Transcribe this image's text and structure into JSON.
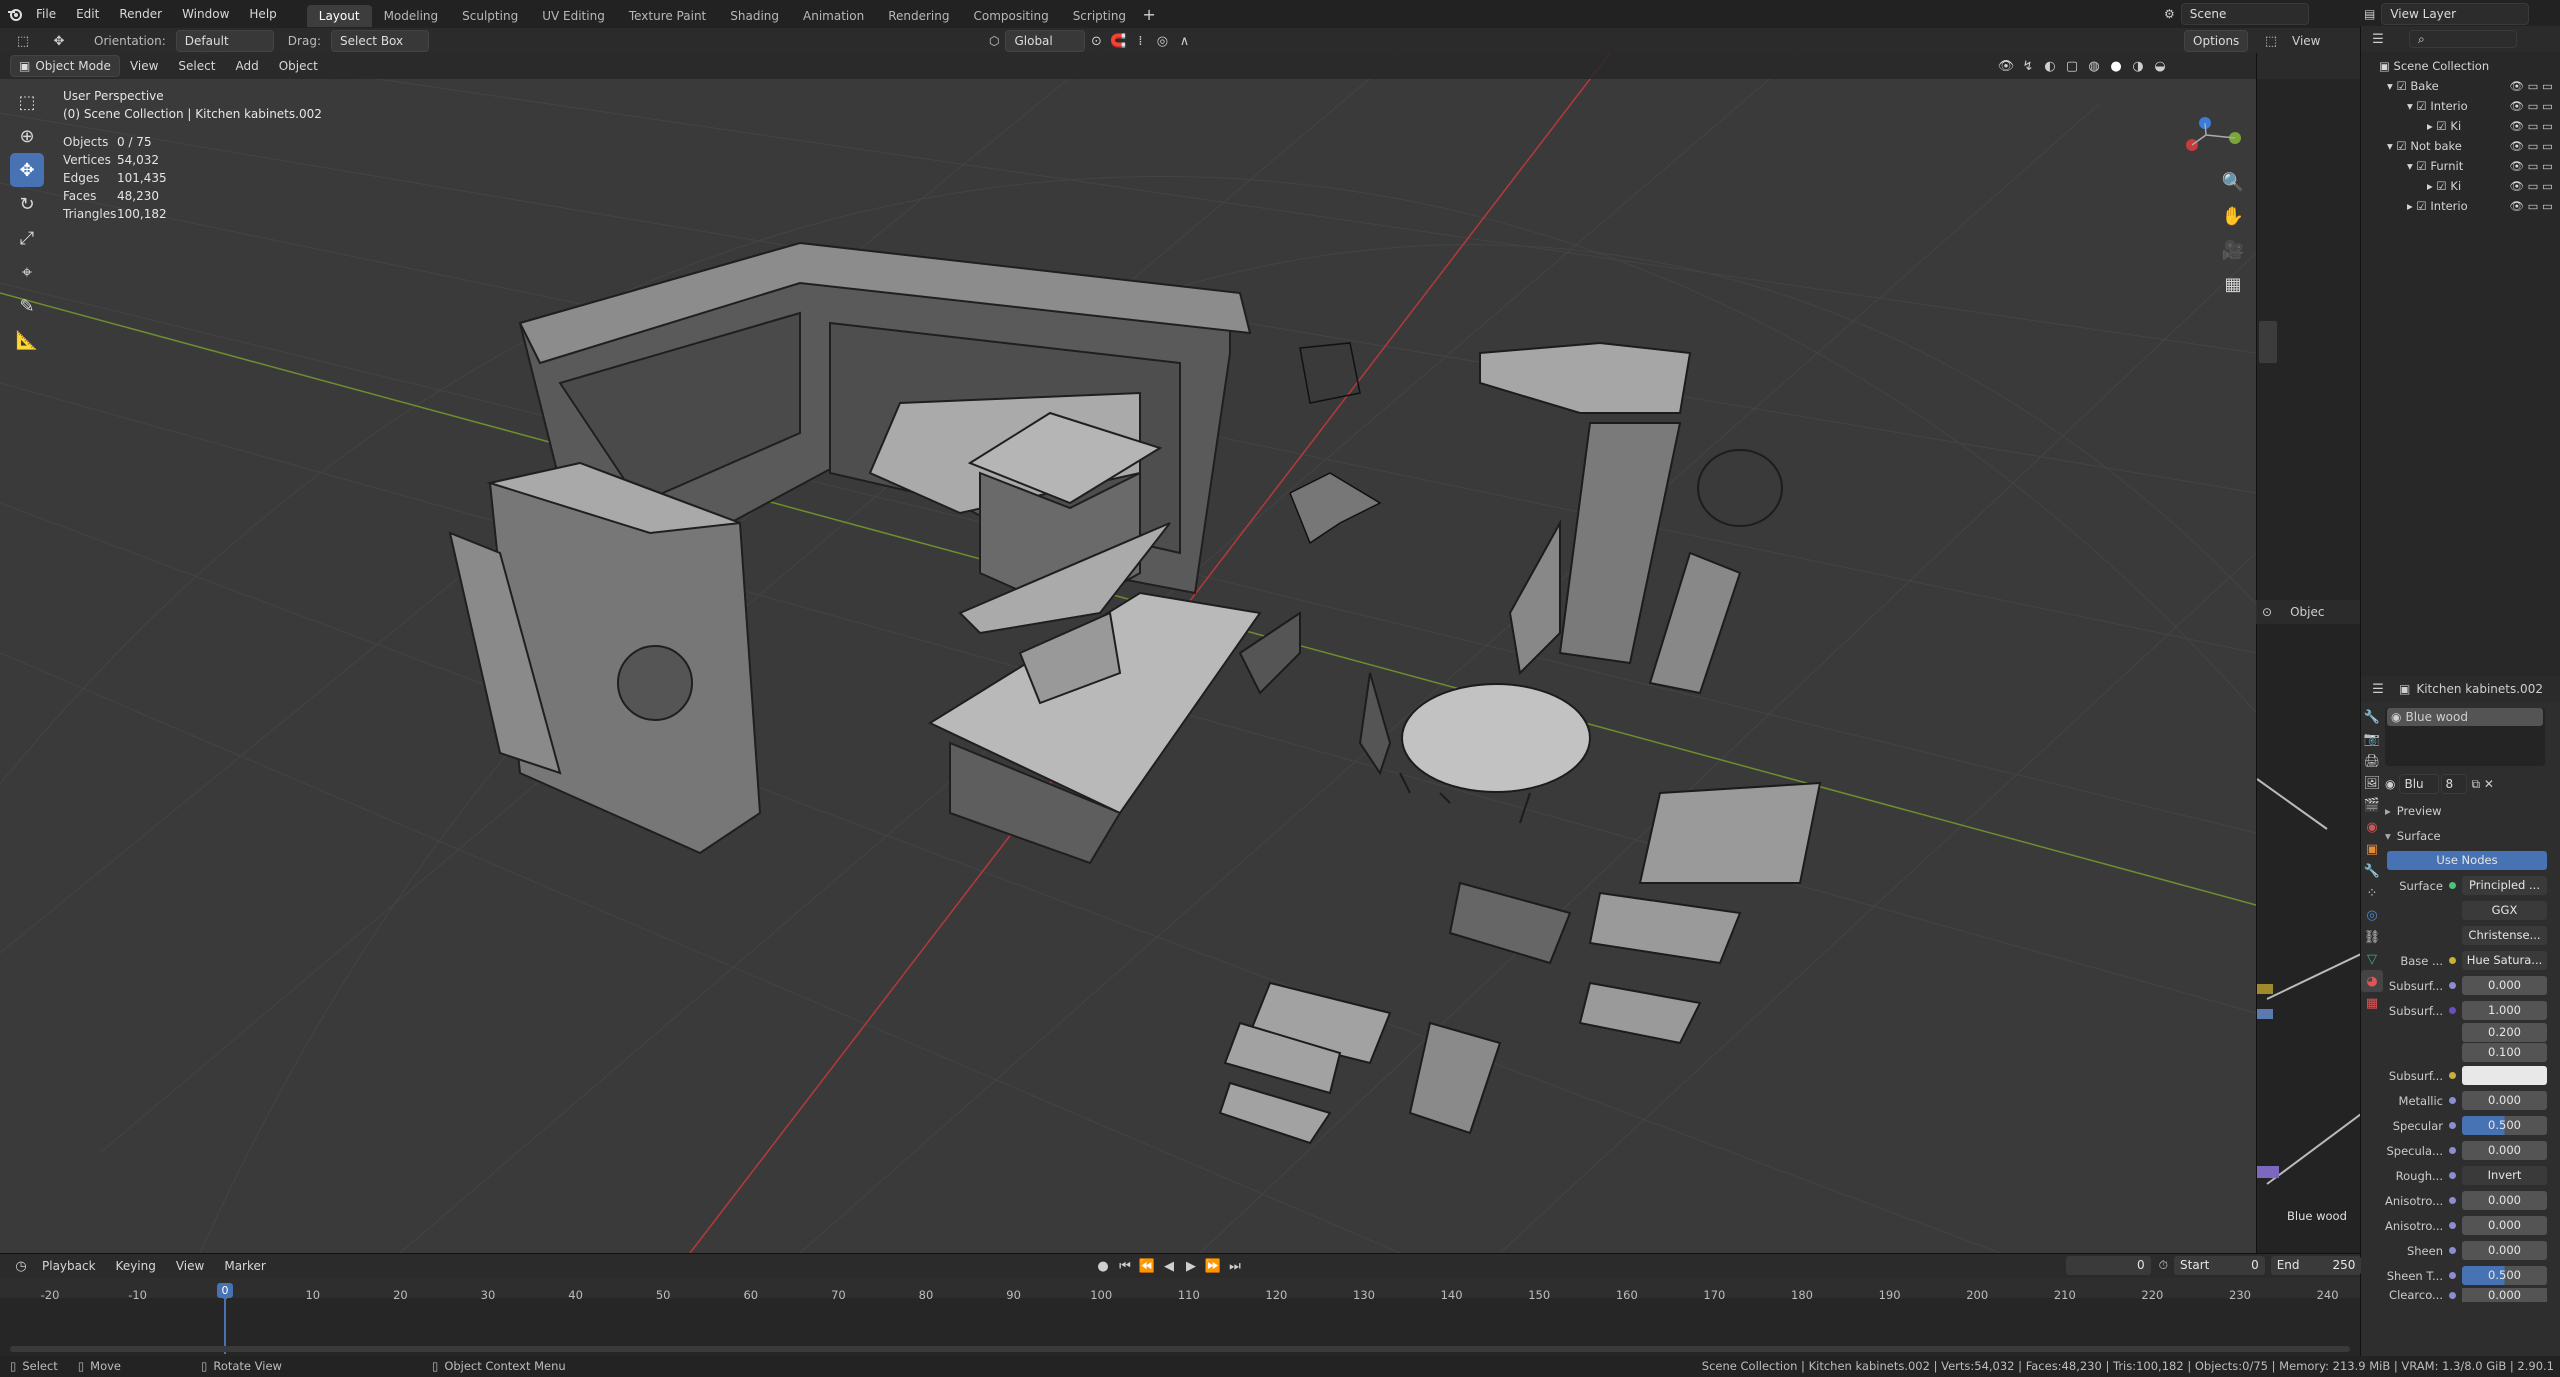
{
  "topbar": {
    "menus": [
      "File",
      "Edit",
      "Render",
      "Window",
      "Help"
    ],
    "workspaces": [
      "Layout",
      "Modeling",
      "Sculpting",
      "UV Editing",
      "Texture Paint",
      "Shading",
      "Animation",
      "Rendering",
      "Compositing",
      "Scripting"
    ],
    "active_workspace": "Layout",
    "scene_label": "Scene",
    "view_layer_label": "View Layer"
  },
  "tool_header": {
    "orientation_label": "Orientation:",
    "orientation_value": "Default",
    "drag_label": "Drag:",
    "drag_value": "Select Box",
    "transform_orientation": "Global",
    "options_label": "Options"
  },
  "viewport_header": {
    "mode": "Object Mode",
    "menus": [
      "View",
      "Select",
      "Add",
      "Object"
    ]
  },
  "viewport_overlay": {
    "perspective": "User Perspective",
    "collection_path": "(0) Scene Collection | Kitchen kabinets.002",
    "stats": [
      {
        "label": "Objects",
        "value": "0 / 75"
      },
      {
        "label": "Vertices",
        "value": "54,032"
      },
      {
        "label": "Edges",
        "value": "101,435"
      },
      {
        "label": "Faces",
        "value": "48,230"
      },
      {
        "label": "Triangles",
        "value": "100,182"
      }
    ]
  },
  "outliner": {
    "view_label": "View",
    "rows": [
      {
        "label": "Scene Collection",
        "indent": 0
      },
      {
        "label": "Bake",
        "indent": 1
      },
      {
        "label": "Interio",
        "indent": 2
      },
      {
        "label": "Ki",
        "indent": 3
      },
      {
        "label": "Not bake",
        "indent": 1
      },
      {
        "label": "Furnit",
        "indent": 2
      },
      {
        "label": "Ki",
        "indent": 3
      },
      {
        "label": "Interio",
        "indent": 2
      }
    ]
  },
  "mid_panel": {
    "object_label": "Objec"
  },
  "properties": {
    "object_name": "Kitchen kabinets.002",
    "material_slot": "Blue wood",
    "material_short": "Blu",
    "user_count": "8",
    "preview_label": "Preview",
    "surface_section": "Surface",
    "use_nodes_label": "Use Nodes",
    "surface_label": "Surface",
    "surface_value": "Principled ...",
    "distribution": "GGX",
    "subsurface_method": "Christense...",
    "rows": [
      {
        "label": "Base ...",
        "value": "Hue Satura...",
        "dot": "#c7b03a",
        "kind": "link"
      },
      {
        "label": "Subsurf...",
        "value": "0.000",
        "dot": "#8c8cd0",
        "kind": "num"
      },
      {
        "label": "Subsurf...",
        "value": "1.000",
        "dot": "#6a4fc0",
        "kind": "num"
      },
      {
        "label": "",
        "value": "0.200",
        "dot": "",
        "kind": "num"
      },
      {
        "label": "",
        "value": "0.100",
        "dot": "",
        "kind": "num"
      },
      {
        "label": "Subsurf...",
        "value": "",
        "dot": "#c7b03a",
        "kind": "color"
      },
      {
        "label": "Metallic",
        "value": "0.000",
        "dot": "#8c8cd0",
        "kind": "num"
      },
      {
        "label": "Specular",
        "value": "0.500",
        "dot": "#8c8cd0",
        "kind": "blue"
      },
      {
        "label": "Specula...",
        "value": "0.000",
        "dot": "#8c8cd0",
        "kind": "num"
      },
      {
        "label": "Rough...",
        "value": "Invert",
        "dot": "#8c8cd0",
        "kind": "link"
      },
      {
        "label": "Anisotro...",
        "value": "0.000",
        "dot": "#8c8cd0",
        "kind": "num"
      },
      {
        "label": "Anisotro...",
        "value": "0.000",
        "dot": "#8c8cd0",
        "kind": "num"
      },
      {
        "label": "Sheen",
        "value": "0.000",
        "dot": "#8c8cd0",
        "kind": "num"
      },
      {
        "label": "Sheen T...",
        "value": "0.500",
        "dot": "#8c8cd0",
        "kind": "blue"
      },
      {
        "label": "Clearco...",
        "value": "0.000",
        "dot": "#8c8cd0",
        "kind": "num"
      }
    ]
  },
  "node_strip": {
    "node_label": "Blue wood"
  },
  "timeline": {
    "menus": [
      "Playback",
      "Keying",
      "View",
      "Marker"
    ],
    "current_frame": "0",
    "start_label": "Start",
    "start_value": "0",
    "end_label": "End",
    "end_value": "250",
    "playhead_frame": "0",
    "ticks": [
      "-20",
      "-10",
      "0",
      "10",
      "20",
      "30",
      "40",
      "50",
      "60",
      "70",
      "80",
      "90",
      "100",
      "110",
      "120",
      "130",
      "140",
      "150",
      "160",
      "170",
      "180",
      "190",
      "200",
      "210",
      "220",
      "230",
      "240"
    ]
  },
  "statusbar": {
    "select": "Select",
    "move": "Move",
    "rotate": "Rotate View",
    "context": "Object Context Menu",
    "info": "Scene Collection | Kitchen kabinets.002 | Verts:54,032 | Faces:48,230 | Tris:100,182 | Objects:0/75 | Memory: 213.9 MiB | VRAM: 1.3/8.0 GiB | 2.90.1"
  },
  "colors": {
    "accent": "#4772b3",
    "x_axis": "#c43c3c",
    "y_axis": "#7aa637",
    "z_axis": "#3c7cd6"
  }
}
